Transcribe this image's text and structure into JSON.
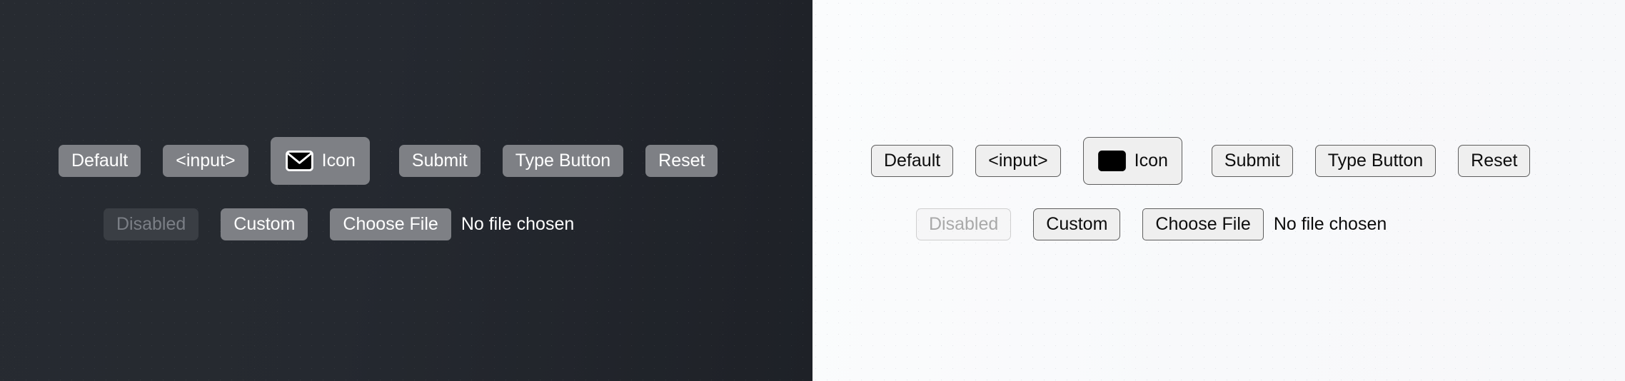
{
  "panels": [
    {
      "name": "dark-theme-panel",
      "theme": "dark",
      "background": "#24282e",
      "button_bg": "#7e8085",
      "button_text": "#ffffff",
      "disabled_bg": "#3a3e44",
      "disabled_text": "#7b7f86",
      "row1": {
        "default_label": "Default",
        "input_label": "<input>",
        "icon_label": "Icon",
        "icon_name": "mail-icon",
        "submit_label": "Submit",
        "type_button_label": "Type Button",
        "reset_label": "Reset"
      },
      "row2": {
        "disabled_label": "Disabled",
        "custom_label": "Custom",
        "choose_file_label": "Choose File",
        "file_status": "No file chosen"
      }
    },
    {
      "name": "light-theme-panel",
      "theme": "light",
      "background": "#f9fafb",
      "button_bg": "#efefef",
      "button_text": "#0d0d0d",
      "button_border": "#5d5d5d",
      "disabled_bg": "#efefef",
      "disabled_text": "#a9a9a9",
      "row1": {
        "default_label": "Default",
        "input_label": "<input>",
        "icon_label": "Icon",
        "icon_name": "mail-icon",
        "submit_label": "Submit",
        "type_button_label": "Type Button",
        "reset_label": "Reset"
      },
      "row2": {
        "disabled_label": "Disabled",
        "custom_label": "Custom",
        "choose_file_label": "Choose File",
        "file_status": "No file chosen"
      }
    }
  ]
}
